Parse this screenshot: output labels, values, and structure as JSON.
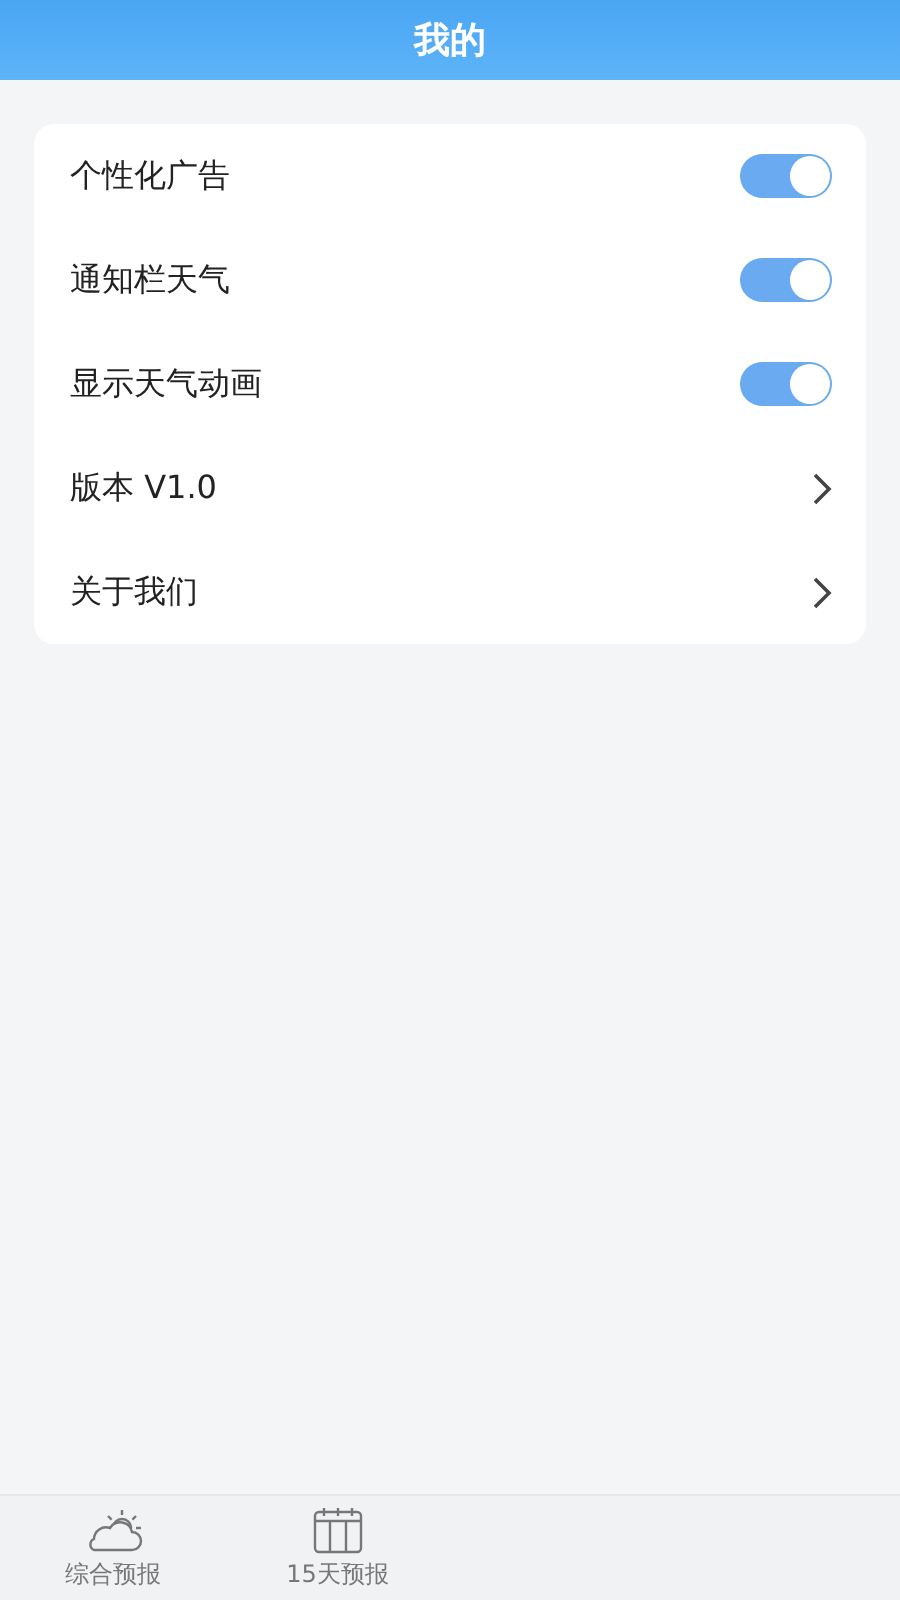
{
  "header": {
    "title": "我的"
  },
  "settings": [
    {
      "kind": "toggle",
      "label": "个性化广告",
      "on": true
    },
    {
      "kind": "toggle",
      "label": "通知栏天气",
      "on": true
    },
    {
      "kind": "toggle",
      "label": "显示天气动画",
      "on": true
    },
    {
      "kind": "link",
      "label": "版本 V1.0"
    },
    {
      "kind": "link",
      "label": "关于我们"
    }
  ],
  "tab_bar": [
    {
      "kind": "weather",
      "label": "综合预报",
      "selected": false
    },
    {
      "kind": "calendar",
      "label": "15天预报",
      "selected": false
    }
  ]
}
